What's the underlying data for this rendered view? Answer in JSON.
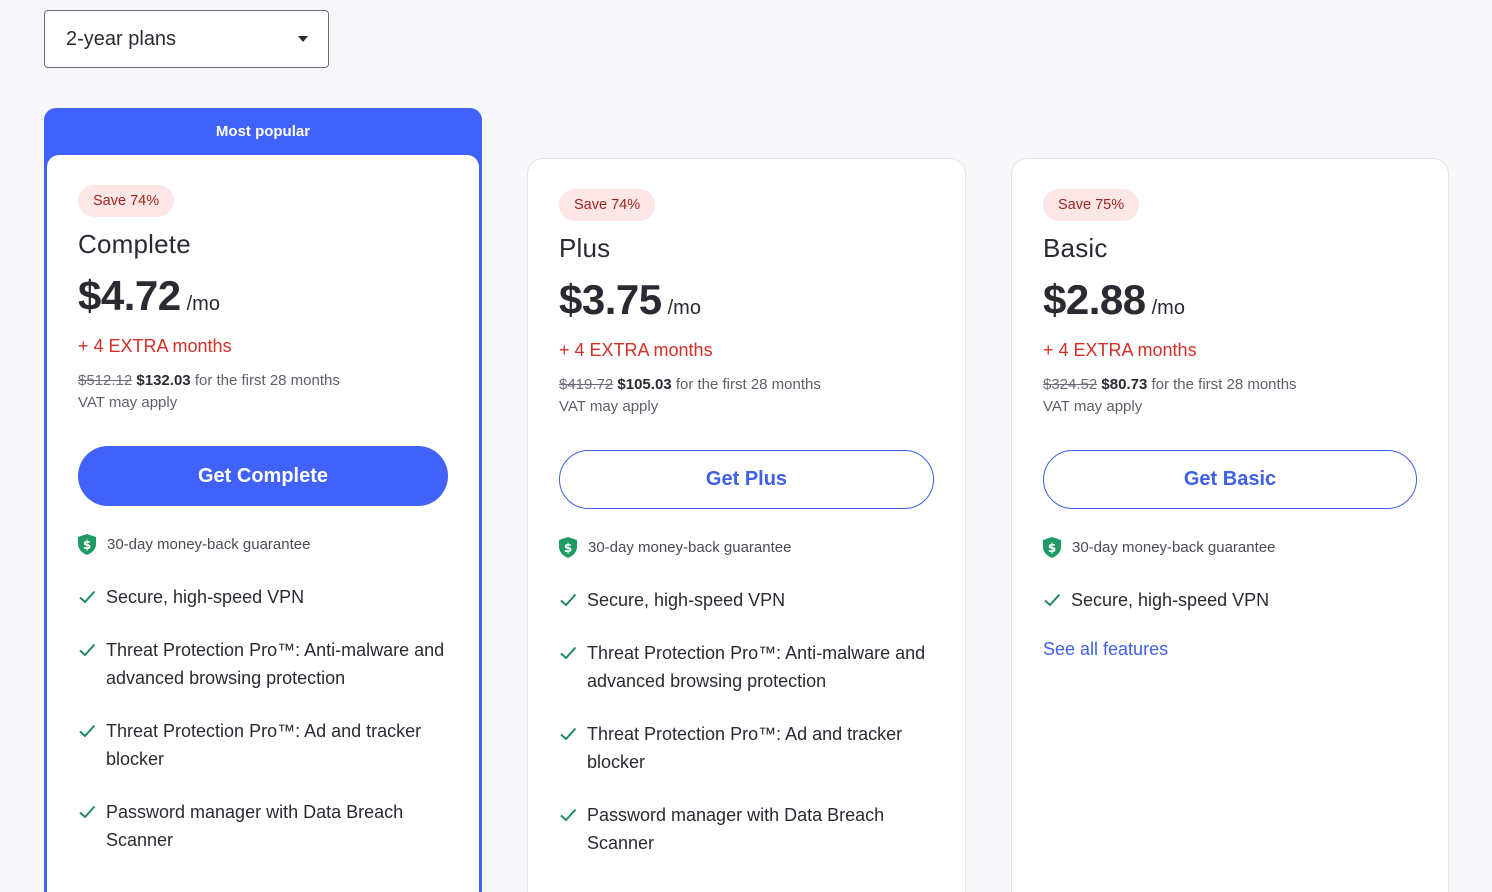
{
  "selector": {
    "label": "2-year plans"
  },
  "colors": {
    "accent": "#4162f8",
    "extra": "#d22f27",
    "badge_bg": "#fce7e6",
    "check": "#1f8a5c"
  },
  "plans": [
    {
      "banner": "Most popular",
      "badge": "Save 74%",
      "name": "Complete",
      "price": "$4.72",
      "per": "/mo",
      "extra": "+ 4 EXTRA months",
      "old_price": "$512.12",
      "new_price": "$132.03",
      "period": "for the first 28 months",
      "vat": "VAT may apply",
      "cta": "Get Complete",
      "guarantee": "30-day money-back guarantee",
      "features": [
        "Secure, high-speed VPN",
        "Threat Protection Pro™: Anti-malware and advanced browsing protection",
        "Threat Protection Pro™: Ad and tracker blocker",
        "Password manager with Data Breach Scanner"
      ]
    },
    {
      "badge": "Save 74%",
      "name": "Plus",
      "price": "$3.75",
      "per": "/mo",
      "extra": "+ 4 EXTRA months",
      "old_price": "$419.72",
      "new_price": "$105.03",
      "period": "for the first 28 months",
      "vat": "VAT may apply",
      "cta": "Get Plus",
      "guarantee": "30-day money-back guarantee",
      "features": [
        "Secure, high-speed VPN",
        "Threat Protection Pro™: Anti-malware and advanced browsing protection",
        "Threat Protection Pro™: Ad and tracker blocker",
        "Password manager with Data Breach Scanner"
      ]
    },
    {
      "badge": "Save 75%",
      "name": "Basic",
      "price": "$2.88",
      "per": "/mo",
      "extra": "+ 4 EXTRA months",
      "old_price": "$324.52",
      "new_price": "$80.73",
      "period": "for the first 28 months",
      "vat": "VAT may apply",
      "cta": "Get Basic",
      "guarantee": "30-day money-back guarantee",
      "features": [
        "Secure, high-speed VPN"
      ],
      "see_all": "See all features"
    }
  ]
}
